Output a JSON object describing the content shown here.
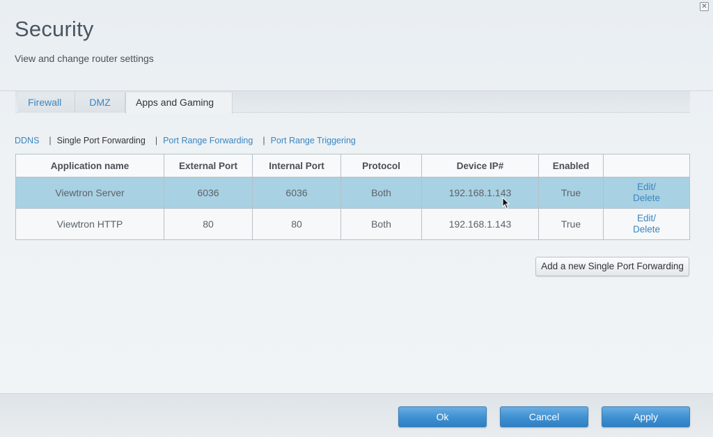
{
  "window": {
    "close_icon": "close-icon"
  },
  "header": {
    "title": "Security",
    "subtitle": "View and change router settings"
  },
  "tabs": [
    {
      "label": "Firewall",
      "active": false
    },
    {
      "label": "DMZ",
      "active": false
    },
    {
      "label": "Apps and Gaming",
      "active": true
    }
  ],
  "subnav": {
    "items": [
      {
        "label": "DDNS",
        "current": false
      },
      {
        "label": "Single Port Forwarding",
        "current": true
      },
      {
        "label": "Port Range Forwarding",
        "current": false
      },
      {
        "label": "Port Range Triggering",
        "current": false
      }
    ],
    "separator": "|"
  },
  "table": {
    "headers": [
      "Application name",
      "External Port",
      "Internal Port",
      "Protocol",
      "Device IP#",
      "Enabled",
      ""
    ],
    "rows": [
      {
        "app": "Viewtron Server",
        "external": "6036",
        "internal": "6036",
        "protocol": "Both",
        "ip": "192.168.1.143",
        "enabled": "True",
        "edit": "Edit/",
        "delete": "Delete",
        "selected": true
      },
      {
        "app": "Viewtron HTTP",
        "external": "80",
        "internal": "80",
        "protocol": "Both",
        "ip": "192.168.1.143",
        "enabled": "True",
        "edit": "Edit/",
        "delete": "Delete",
        "selected": false
      }
    ]
  },
  "add_button": "Add a new Single Port Forwarding",
  "footer": {
    "ok": "Ok",
    "cancel": "Cancel",
    "apply": "Apply"
  },
  "colors": {
    "link": "#3a86c0",
    "selected_row": "#a8d1e3",
    "primary_button": "#3d8fd0",
    "title": "#4a5560"
  }
}
